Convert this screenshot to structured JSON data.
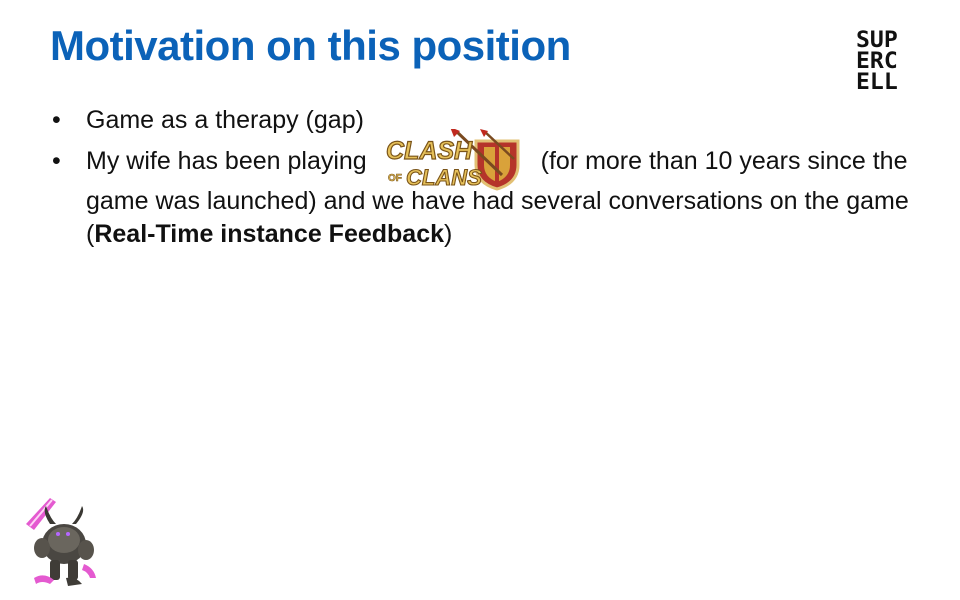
{
  "slide": {
    "title": "Motivation on this position",
    "logo": {
      "lines": [
        "SUP",
        "ERC",
        "ELL"
      ]
    },
    "bullets": [
      {
        "text": "Game as a therapy (gap)"
      },
      {
        "text_before_logo": "My wife has been playing",
        "game_logo": {
          "icon": "clash-of-clans-logo",
          "line1": "CLASH",
          "of": "OF",
          "line2": "CLANS"
        },
        "text_after_logo": "(for more than 10 years since the game was launched) and we have had several conversations on the game (",
        "bold_text": "Real-Time instance Feedback",
        "text_end": ")"
      }
    ],
    "bullet_symbol": "•",
    "corner_illustration": "pekka-character-icon"
  },
  "colors": {
    "title": "#0b62b8",
    "text": "#111111",
    "background": "#ffffff"
  }
}
